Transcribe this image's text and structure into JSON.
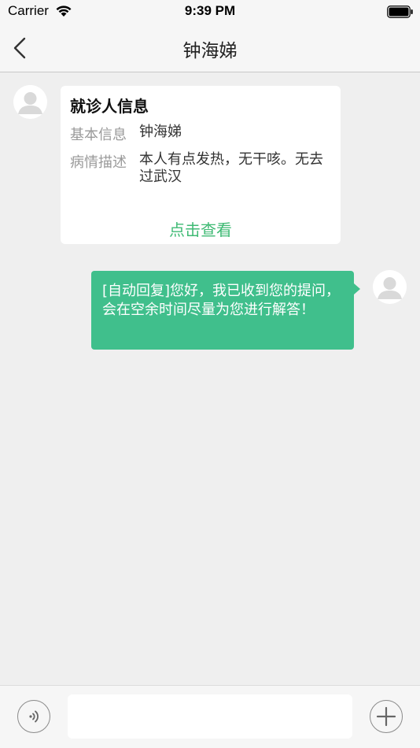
{
  "status_bar": {
    "carrier": "Carrier",
    "time": "9:39 PM"
  },
  "nav": {
    "title": "钟海娣",
    "back_icon": "chevron-left-icon"
  },
  "patient_card": {
    "title": "就诊人信息",
    "rows": [
      {
        "label": "基本信息",
        "value": "钟海娣"
      },
      {
        "label": "病情描述",
        "value": "本人有点发热，无干咳。无去过武汉"
      }
    ],
    "link": "点击查看"
  },
  "messages": [
    {
      "sender": "self",
      "text": "[自动回复]您好，我已收到您的提问，会在空余时间尽量为您进行解答！"
    }
  ],
  "input_bar": {
    "voice_icon": "voice-icon",
    "input_value": "",
    "input_placeholder": "",
    "plus_icon": "plus-icon"
  },
  "colors": {
    "accent_green": "#3fba74",
    "bubble_green": "#40bf8c",
    "chat_background": "#efefef"
  }
}
